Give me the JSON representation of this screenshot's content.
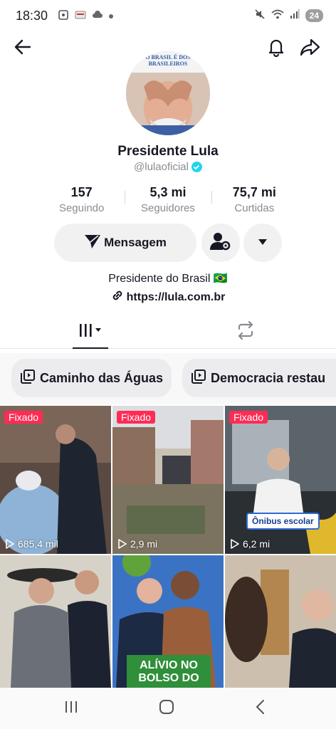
{
  "status": {
    "time": "18:30",
    "battery": "24"
  },
  "profile": {
    "name": "Presidente Lula",
    "handle": "@lulaoficial",
    "avatar_caption": "O BRASIL É DOS BRASILEIROS",
    "bio": "Presidente do Brasil 🇧🇷",
    "link": "https://lula.com.br"
  },
  "stats": [
    {
      "value": "157",
      "label": "Seguindo"
    },
    {
      "value": "5,3 mi",
      "label": "Seguidores"
    },
    {
      "value": "75,7 mi",
      "label": "Curtidas"
    }
  ],
  "actions": {
    "message_label": "Mensagem"
  },
  "playlists": [
    {
      "label": "Caminho das Águas"
    },
    {
      "label": "Democracia restau"
    }
  ],
  "videos": [
    {
      "pinned_label": "Fixado",
      "views": "685,4 mil",
      "overlay": ""
    },
    {
      "pinned_label": "Fixado",
      "views": "2,9 mi",
      "overlay": ""
    },
    {
      "pinned_label": "Fixado",
      "views": "6,2 mi",
      "overlay": "Ônibus escolar"
    },
    {
      "pinned_label": "",
      "views": "",
      "overlay": ""
    },
    {
      "pinned_label": "",
      "views": "",
      "overlay": "ALÍVIO NO BOLSO DO"
    },
    {
      "pinned_label": "",
      "views": "",
      "overlay": ""
    }
  ],
  "colors": {
    "accent": "#fe2c55",
    "verified": "#20d5ec",
    "text": "#161823",
    "muted": "#8a8b91"
  }
}
